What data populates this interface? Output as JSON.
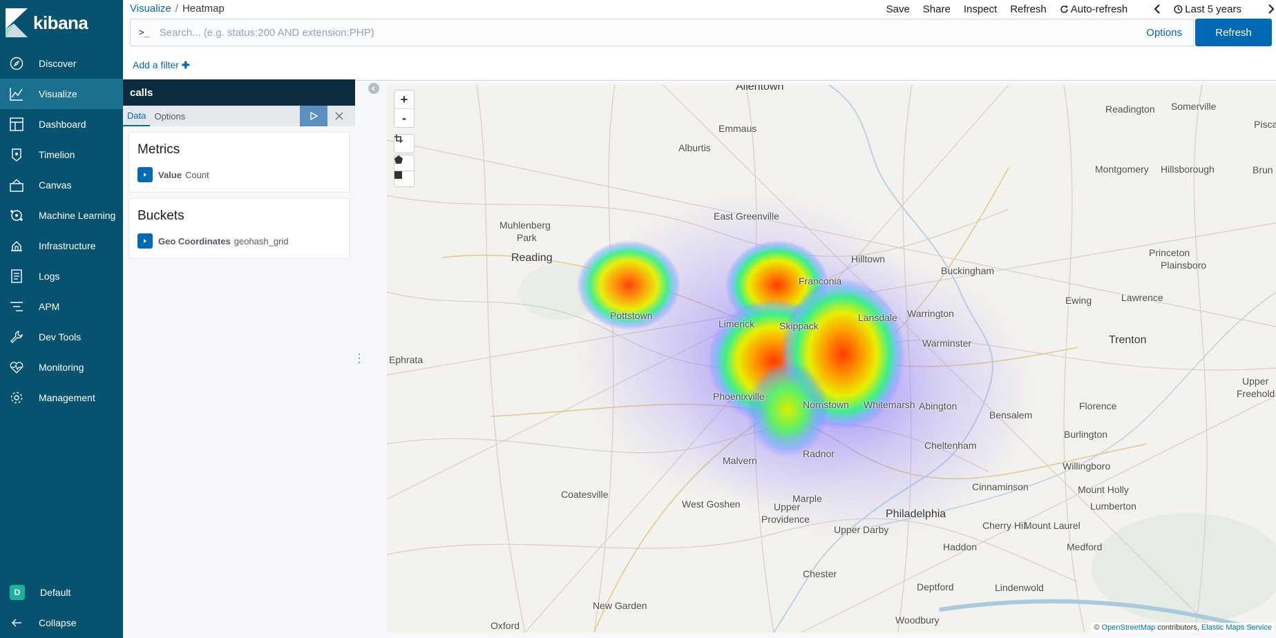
{
  "app": {
    "brand": "kibana"
  },
  "sidebar": {
    "items": [
      {
        "label": "Discover",
        "icon": "compass-icon",
        "active": false
      },
      {
        "label": "Visualize",
        "icon": "visualize-icon",
        "active": true
      },
      {
        "label": "Dashboard",
        "icon": "dashboard-icon",
        "active": false
      },
      {
        "label": "Timelion",
        "icon": "timelion-icon",
        "active": false
      },
      {
        "label": "Canvas",
        "icon": "canvas-icon",
        "active": false
      },
      {
        "label": "Machine Learning",
        "icon": "machine-learning-icon",
        "active": false
      },
      {
        "label": "Infrastructure",
        "icon": "infrastructure-icon",
        "active": false
      },
      {
        "label": "Logs",
        "icon": "logs-icon",
        "active": false
      },
      {
        "label": "APM",
        "icon": "apm-icon",
        "active": false
      },
      {
        "label": "Dev Tools",
        "icon": "wrench-icon",
        "active": false
      },
      {
        "label": "Monitoring",
        "icon": "heartbeat-icon",
        "active": false
      },
      {
        "label": "Management",
        "icon": "gear-icon",
        "active": false
      }
    ],
    "space": {
      "initial": "D",
      "label": "Default"
    },
    "collapse_label": "Collapse"
  },
  "header": {
    "breadcrumb": {
      "root": "Visualize",
      "current": "Heatmap"
    },
    "menu": {
      "save": "Save",
      "share": "Share",
      "inspect": "Inspect",
      "refresh": "Refresh",
      "auto_refresh": "Auto-refresh",
      "time_range": "Last 5 years"
    },
    "search": {
      "prompt": ">_",
      "placeholder": "Search... (e.g. status:200 AND extension:PHP)",
      "value": "",
      "options_label": "Options"
    },
    "refresh_button": "Refresh",
    "add_filter": "Add a filter"
  },
  "editor": {
    "title": "calls",
    "tabs": [
      "Data",
      "Options"
    ],
    "active_tab": "Data",
    "metrics": {
      "heading": "Metrics",
      "agg_name": "Value",
      "agg_type": "Count"
    },
    "buckets": {
      "heading": "Buckets",
      "agg_name": "Geo Coordinates",
      "agg_type": "geohash_grid"
    }
  },
  "map": {
    "zoom_in": "+",
    "zoom_out": "-",
    "attribution": {
      "copyright": "©",
      "osm": "OpenStreetMap",
      "contributors": "contributors,",
      "ems": "Elastic Maps Service"
    },
    "cities": [
      {
        "name": "Allentown",
        "big": true
      },
      {
        "name": "Emmaus",
        "big": false
      },
      {
        "name": "Alburtis",
        "big": false
      },
      {
        "name": "Readington",
        "big": false
      },
      {
        "name": "Somerville",
        "big": false
      },
      {
        "name": "Piscata",
        "big": false
      },
      {
        "name": "Montgomery",
        "big": false
      },
      {
        "name": "Hillsborough",
        "big": false
      },
      {
        "name": "Brun",
        "big": false
      },
      {
        "name": "East Greenville",
        "big": false
      },
      {
        "name": "Muhlenberg",
        "big": false
      },
      {
        "name": "Park",
        "big": false
      },
      {
        "name": "Reading",
        "big": true
      },
      {
        "name": "Hilltown",
        "big": false
      },
      {
        "name": "Buckingham",
        "big": false
      },
      {
        "name": "Princeton",
        "big": false
      },
      {
        "name": "Plainsboro",
        "big": false
      },
      {
        "name": "Franconia",
        "big": false
      },
      {
        "name": "Ewing",
        "big": false
      },
      {
        "name": "Lawrence",
        "big": false
      },
      {
        "name": "Pottstown",
        "big": false
      },
      {
        "name": "Limerick",
        "big": false
      },
      {
        "name": "Skippack",
        "big": false
      },
      {
        "name": "Lansdale",
        "big": false
      },
      {
        "name": "Warrington",
        "big": false
      },
      {
        "name": "Trenton",
        "big": true
      },
      {
        "name": "Warminster",
        "big": false
      },
      {
        "name": "Ephrata",
        "big": false
      },
      {
        "name": "Phoenixville",
        "big": false
      },
      {
        "name": "Norristown",
        "big": false
      },
      {
        "name": "Whitemarsh",
        "big": false
      },
      {
        "name": "Abington",
        "big": false
      },
      {
        "name": "Florence",
        "big": false
      },
      {
        "name": "Upper",
        "big": false
      },
      {
        "name": "Freehold",
        "big": false
      },
      {
        "name": "Bensalem",
        "big": false
      },
      {
        "name": "Burlington",
        "big": false
      },
      {
        "name": "Cheltenham",
        "big": false
      },
      {
        "name": "Radnor",
        "big": false
      },
      {
        "name": "Malvern",
        "big": false
      },
      {
        "name": "Willingboro",
        "big": false
      },
      {
        "name": "Coatesville",
        "big": false
      },
      {
        "name": "Cinnaminson",
        "big": false
      },
      {
        "name": "Mount Holly",
        "big": false
      },
      {
        "name": "West Goshen",
        "big": false
      },
      {
        "name": "Marple",
        "big": false
      },
      {
        "name": "Upper",
        "big": false
      },
      {
        "name": "Providence",
        "big": false
      },
      {
        "name": "Lumberton",
        "big": false
      },
      {
        "name": "Philadelphia",
        "big": true
      },
      {
        "name": "Cherry Hill",
        "big": false
      },
      {
        "name": "Mount Laurel",
        "big": false
      },
      {
        "name": "Upper Darby",
        "big": false
      },
      {
        "name": "Haddon",
        "big": false
      },
      {
        "name": "Medford",
        "big": false
      },
      {
        "name": "Chester",
        "big": false
      },
      {
        "name": "Deptford",
        "big": false
      },
      {
        "name": "Lindenwold",
        "big": false
      },
      {
        "name": "New Garden",
        "big": false
      },
      {
        "name": "Oxford",
        "big": false
      },
      {
        "name": "Woodbury",
        "big": false
      }
    ]
  },
  "colors": {
    "sidebar": "#07526e",
    "active": "#1b6f8f",
    "primary": "#006bb4"
  }
}
